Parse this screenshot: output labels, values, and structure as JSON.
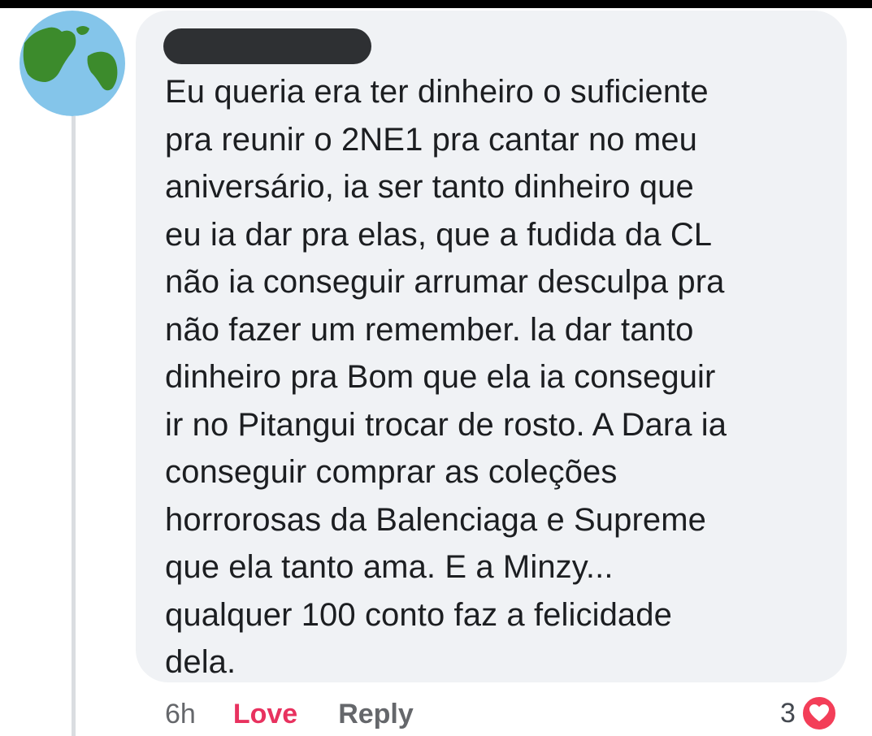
{
  "comment": {
    "lines": [
      "Eu queria era ter dinheiro o suficiente",
      "pra reunir o 2NE1 pra cantar no meu",
      "aniversário, ia ser tanto dinheiro que",
      "eu ia dar pra elas, que a fudida da CL",
      "não ia conseguir arrumar desculpa pra",
      "não fazer um remember. la dar tanto",
      "dinheiro pra Bom que ela ia conseguir",
      "ir no Pitangui trocar de rosto. A Dara ia",
      "conseguir comprar as coleções",
      "horrorosas da Balenciaga e Supreme",
      "que ela tanto ama. E a Minzy...",
      "qualquer 100 conto faz a felicidade",
      "dela."
    ]
  },
  "actions": {
    "time": "6h",
    "love_label": "Love",
    "reply_label": "Reply"
  },
  "reactions": {
    "count": "3",
    "icon": "heart-icon"
  },
  "colors": {
    "bubble_bg": "#f0f2f5",
    "love_red": "#e8325f",
    "heart_red": "#f33e58",
    "secondary_text": "#65676b"
  }
}
